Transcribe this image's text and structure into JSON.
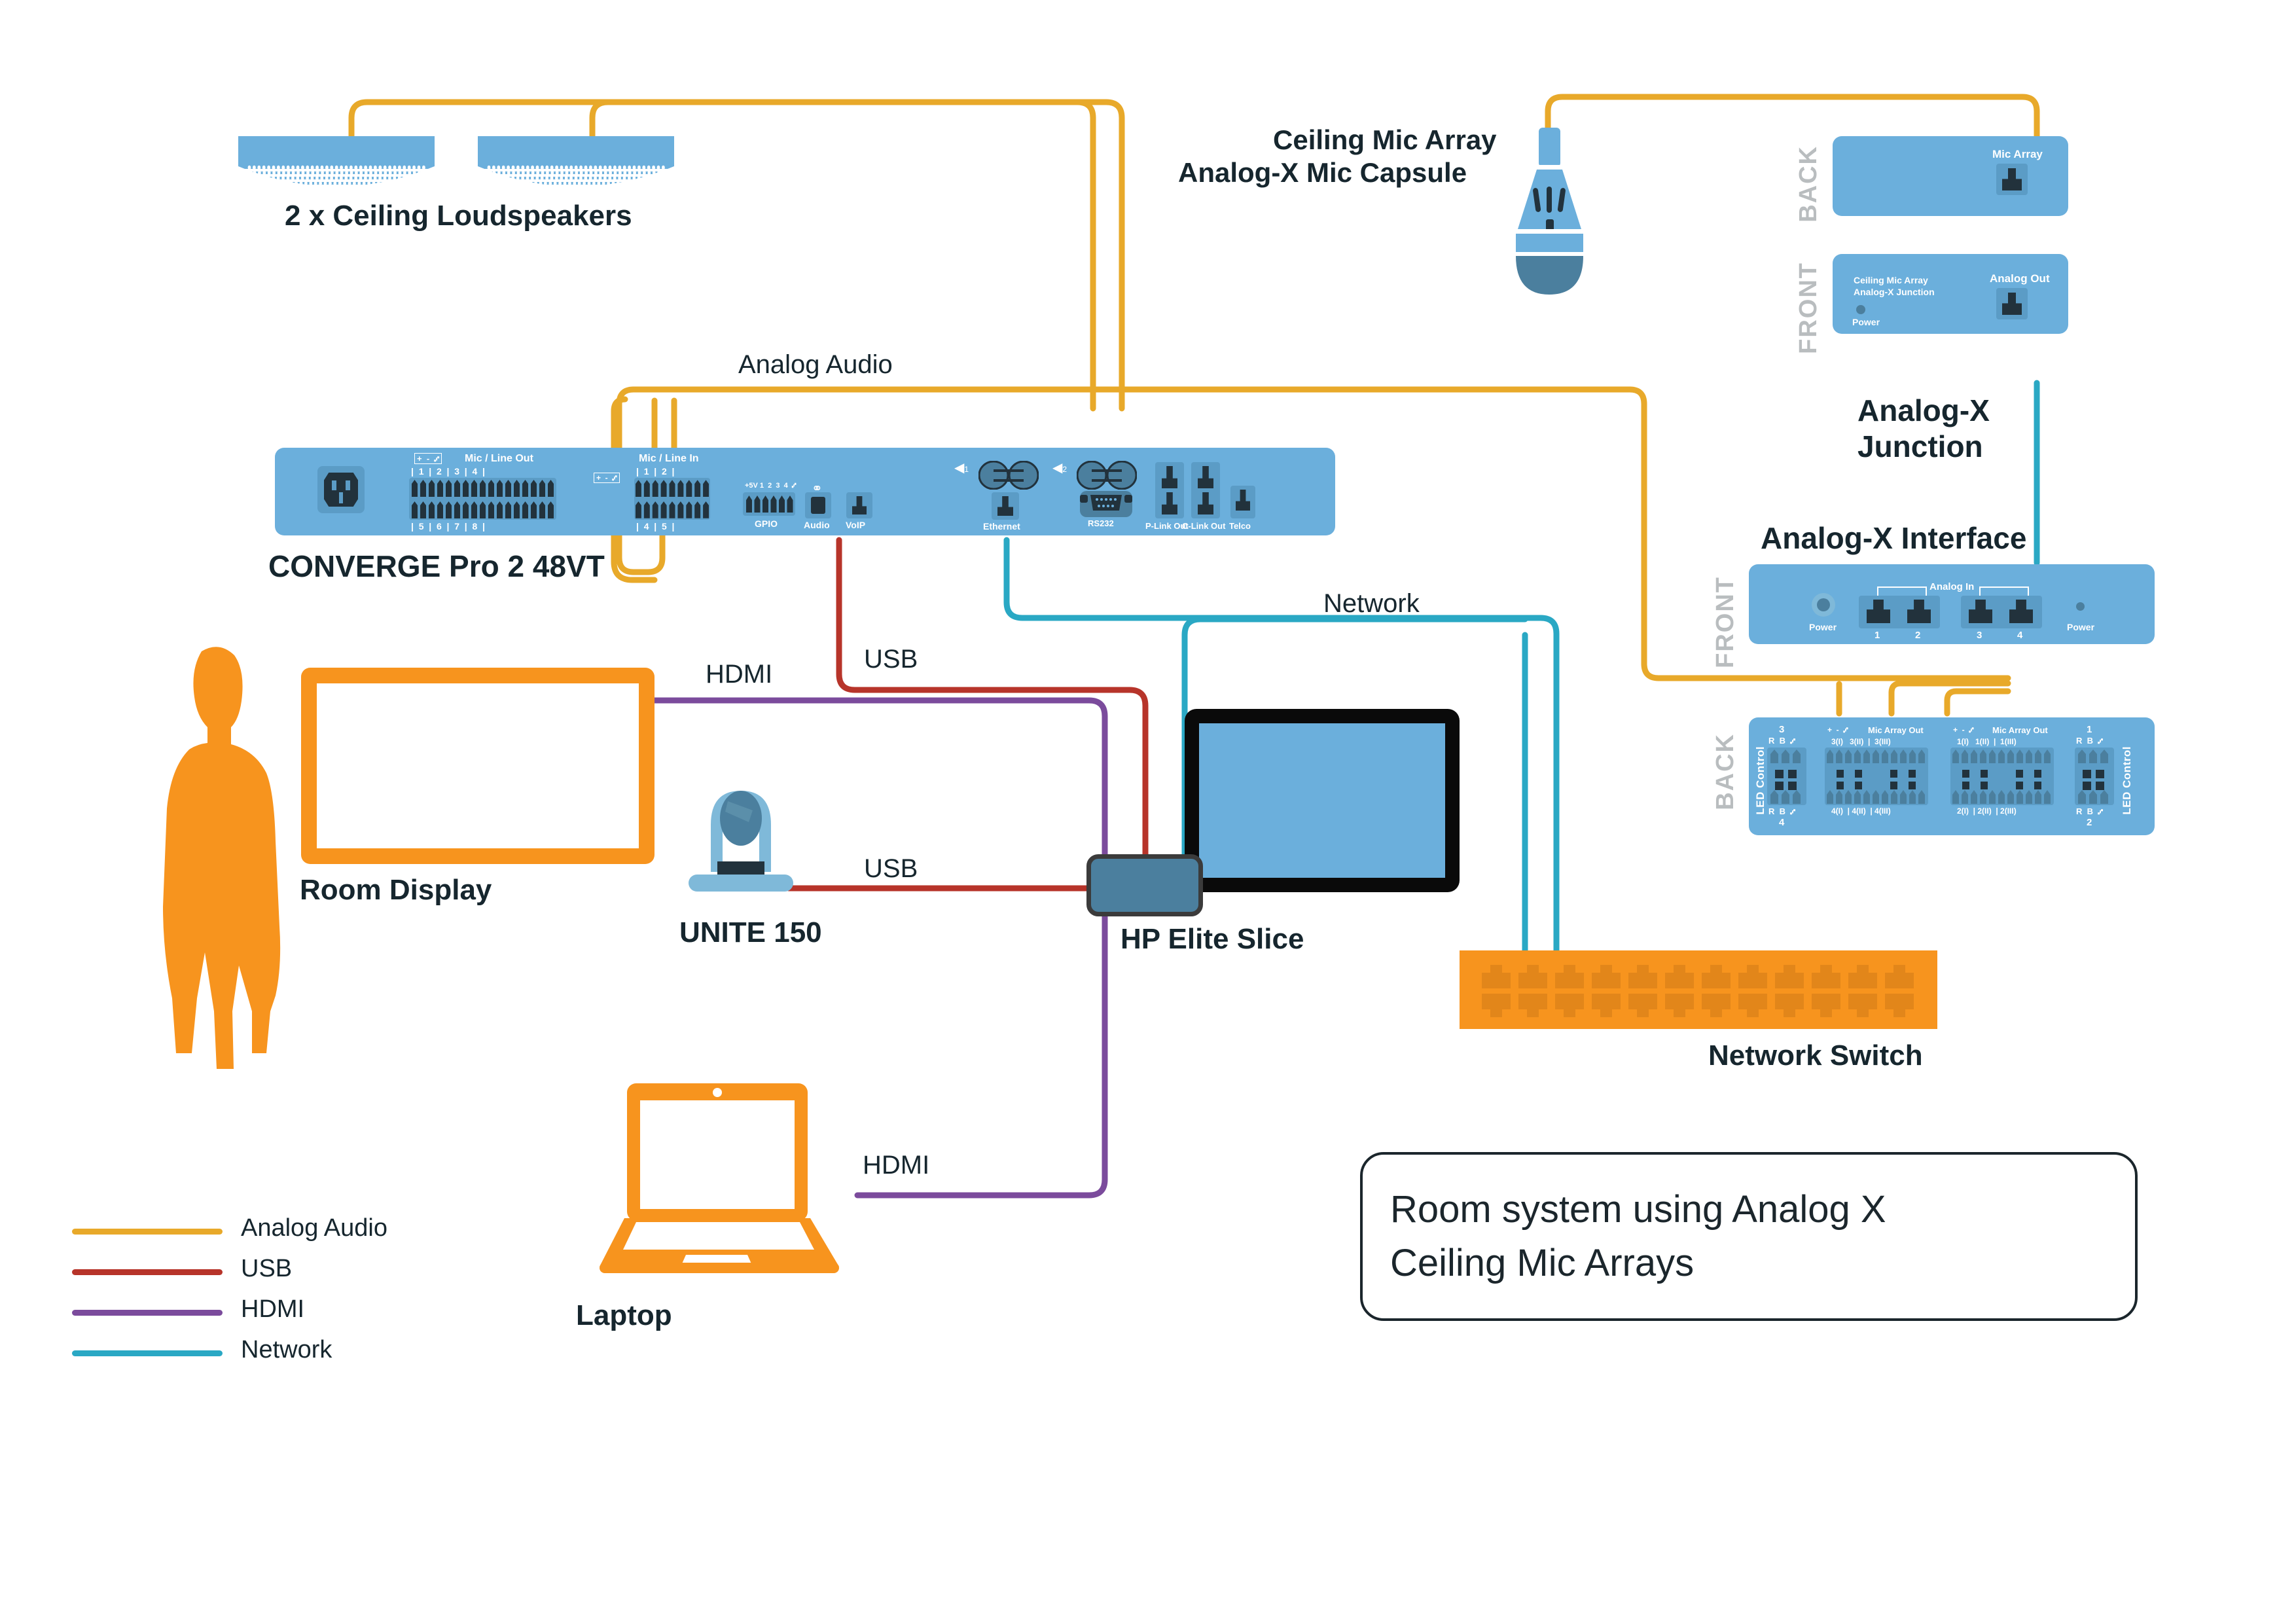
{
  "title_box": {
    "line1": "Room system using Analog X",
    "line2": "Ceiling Mic Arrays"
  },
  "legend": {
    "items": [
      {
        "label": "Analog Audio",
        "color": "#e8a92a"
      },
      {
        "label": "USB",
        "color": "#b7342a"
      },
      {
        "label": "HDMI",
        "color": "#7b4b9c"
      },
      {
        "label": "Network",
        "color": "#2aa8c4"
      }
    ]
  },
  "cable_labels": {
    "analog_audio": "Analog Audio",
    "network": "Network",
    "usb_top": "USB",
    "usb_cam": "USB",
    "hdmi_display": "HDMI",
    "hdmi_laptop": "HDMI"
  },
  "devices": {
    "loudspeakers": {
      "label": "2 x Ceiling Loudspeakers",
      "count": 2
    },
    "ceiling_mic": {
      "label_line1": "Ceiling Mic Array",
      "label_line2": "Analog-X Mic Capsule"
    },
    "converge": {
      "label": "CONVERGE Pro 2 48VT",
      "mic_line_out": {
        "title": "Mic / Line Out",
        "polarity": "+  -  ⑇",
        "top_nums": [
          "1",
          "2",
          "3",
          "4"
        ],
        "bottom_nums": [
          "5",
          "6",
          "7",
          "8"
        ]
      },
      "mic_line_in": {
        "title": "Mic / Line In",
        "polarity": "+  -  ⑇",
        "top_nums": [
          "1",
          "2"
        ],
        "bottom_nums": [
          "4",
          "5"
        ]
      },
      "gpio": {
        "label": "GPIO",
        "pins": "+5V 1  2  3  4  ⑇"
      },
      "audio": {
        "label": "Audio"
      },
      "voip": {
        "label": "VoIP"
      },
      "ethernet": {
        "label": "Ethernet"
      },
      "rs232": {
        "label": "RS232"
      },
      "plink": {
        "label": "P-Link Out"
      },
      "clink": {
        "label": "C-Link Out"
      },
      "telco": {
        "label": "Telco"
      },
      "speaker_marks": [
        "1",
        "2"
      ]
    },
    "analogx_junction": {
      "label_line1": "Analog-X",
      "label_line2": "Junction",
      "back_side": "BACK",
      "front_side": "FRONT",
      "back_port": "Mic Array",
      "front_name_l1": "Ceiling Mic Array",
      "front_name_l2": "Analog-X Junction",
      "front_port": "Analog Out",
      "power_label": "Power"
    },
    "analogx_interface": {
      "label": "Analog-X Interface",
      "front_side": "FRONT",
      "back_side": "BACK",
      "analog_in_title": "Analog In",
      "analog_in_nums": [
        "1",
        "2",
        "3",
        "4"
      ],
      "power_left": "Power",
      "power_right": "Power",
      "back": {
        "led_control": "LED Control",
        "group_left_top_num": "3",
        "group_left_bottom_num": "4",
        "group_right_top_num": "1",
        "group_right_bottom_num": "2",
        "rb_label": "R  B  ⑇",
        "mic_array_out": "Mic Array Out",
        "polarity": "+  -  ⑇",
        "left_top_pins": [
          "3(I)",
          "3(II)",
          "3(III)"
        ],
        "left_bottom_pins": [
          "4(I)",
          "4(II)",
          "4(III)"
        ],
        "right_top_pins": [
          "1(I)",
          "1(II)",
          "1(III)"
        ],
        "right_bottom_pins": [
          "2(I)",
          "2(II)",
          "2(III)"
        ]
      }
    },
    "room_display": {
      "label": "Room Display"
    },
    "camera": {
      "label": "UNITE 150"
    },
    "hp_slice": {
      "label": "HP Elite Slice"
    },
    "network_switch": {
      "label": "Network Switch",
      "port_count": 12
    },
    "laptop": {
      "label": "Laptop"
    },
    "touch_monitor": {
      "label": ""
    },
    "person": {
      "label": ""
    }
  },
  "colors": {
    "device_blue": "#6bafdc",
    "device_blue_dark": "#4b7f9e",
    "jack_dark": "#22323c",
    "orange": "#f7941e",
    "analog_audio": "#e8a92a",
    "usb": "#b7342a",
    "hdmi": "#7b4b9c",
    "network": "#2aa8c4",
    "text": "#16262e"
  }
}
